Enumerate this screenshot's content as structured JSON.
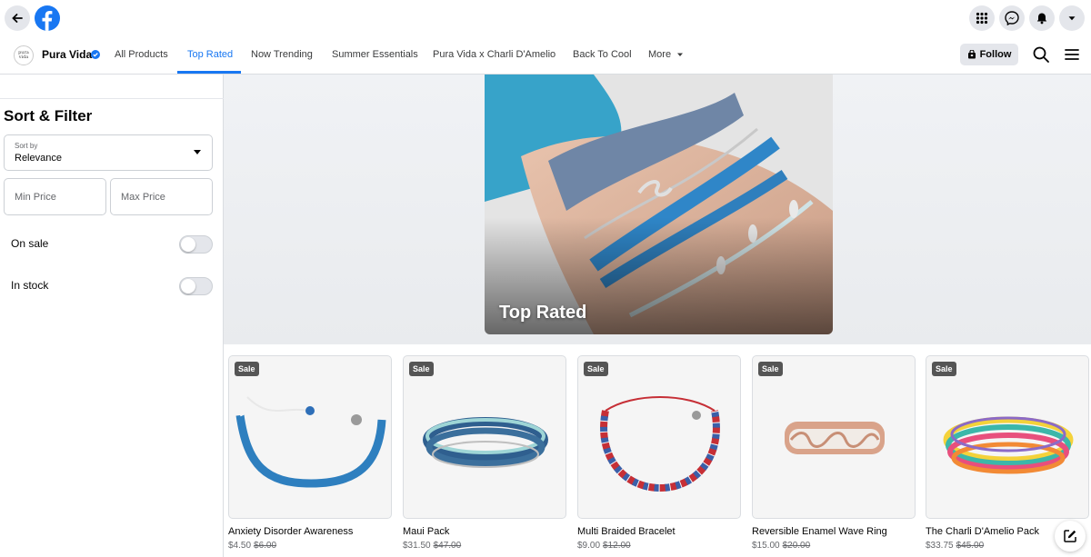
{
  "topbar": {
    "back_icon": "arrow-left-icon",
    "logo_icon": "facebook-logo-icon",
    "right_icons": [
      "menu-grid-icon",
      "messenger-icon",
      "notifications-bell-icon",
      "account-caret-icon"
    ]
  },
  "shop": {
    "avatar_text": "pura vida",
    "name": "Pura Vida",
    "tabs": [
      {
        "label": "All Products"
      },
      {
        "label": "Top Rated"
      },
      {
        "label": "Now Trending"
      },
      {
        "label": "Summer Essentials"
      },
      {
        "label": "Pura Vida x Charli D'Amelio"
      },
      {
        "label": "Back To Cool"
      },
      {
        "label": "More"
      }
    ],
    "active_tab": "Top Rated",
    "follow_label": "Follow",
    "accent_color": "#1877f2"
  },
  "sidebar": {
    "title": "Sort & Filter",
    "sort_label": "Sort by",
    "sort_value": "Relevance",
    "min_price_placeholder": "Min Price",
    "max_price_placeholder": "Max Price",
    "on_sale_label": "On sale",
    "in_stock_label": "In stock",
    "on_sale_enabled": false,
    "in_stock_enabled": false
  },
  "hero": {
    "title": "Top Rated"
  },
  "products": [
    {
      "badge": "Sale",
      "name": "Anxiety Disorder Awareness",
      "price": "$4.50",
      "old_price": "$6.00"
    },
    {
      "badge": "Sale",
      "name": "Maui Pack",
      "price": "$31.50",
      "old_price": "$47.00"
    },
    {
      "badge": "Sale",
      "name": "Multi Braided Bracelet",
      "price": "$9.00",
      "old_price": "$12.00"
    },
    {
      "badge": "Sale",
      "name": "Reversible Enamel Wave Ring",
      "price": "$15.00",
      "old_price": "$20.00"
    },
    {
      "badge": "Sale",
      "name": "The Charli D'Amelio Pack",
      "price": "$33.75",
      "old_price": "$45.00"
    }
  ]
}
